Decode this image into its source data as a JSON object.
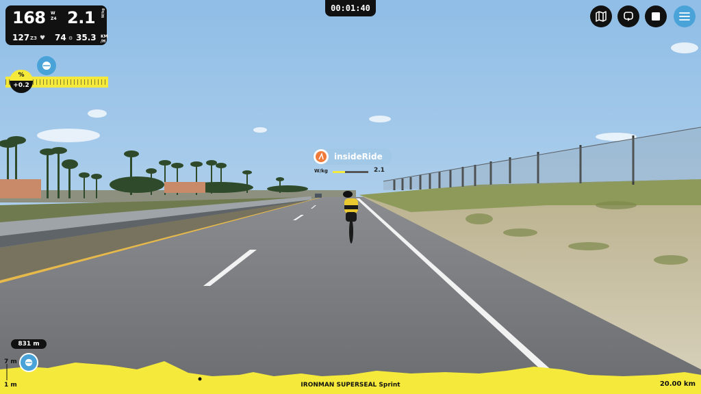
{
  "stats": {
    "power": "168",
    "power_unit_top": "W",
    "power_zone": "Z4",
    "wkg": "2.1",
    "wkg_unit": "W/kg",
    "heart_rate": "127",
    "hr_zone": "Z3",
    "cadence": "74",
    "speed": "35.3",
    "speed_unit_top": "KM",
    "speed_unit_bottom": "/H"
  },
  "timer": "00:01:40",
  "gradient": {
    "symbol": "%",
    "value": "+0.2"
  },
  "rider": {
    "name": "insideRide",
    "wkg_label": "W/kg",
    "wkg_value": "2.1",
    "wkg_fraction": 0.35
  },
  "toolbar": {
    "buttons": [
      "map-icon",
      "replay-icon",
      "stop-icon",
      "menu-icon"
    ]
  },
  "elevation": {
    "distance_pill": "831 m",
    "max_label": "7 m",
    "min_label": "1 m",
    "route_name": "IRONMAN SUPERSEAL Sprint",
    "total_distance": "20.00 km"
  },
  "colors": {
    "accent_yellow": "#f5ea3b",
    "accent_blue": "#4aa3d8",
    "panel_dark": "#111111"
  }
}
